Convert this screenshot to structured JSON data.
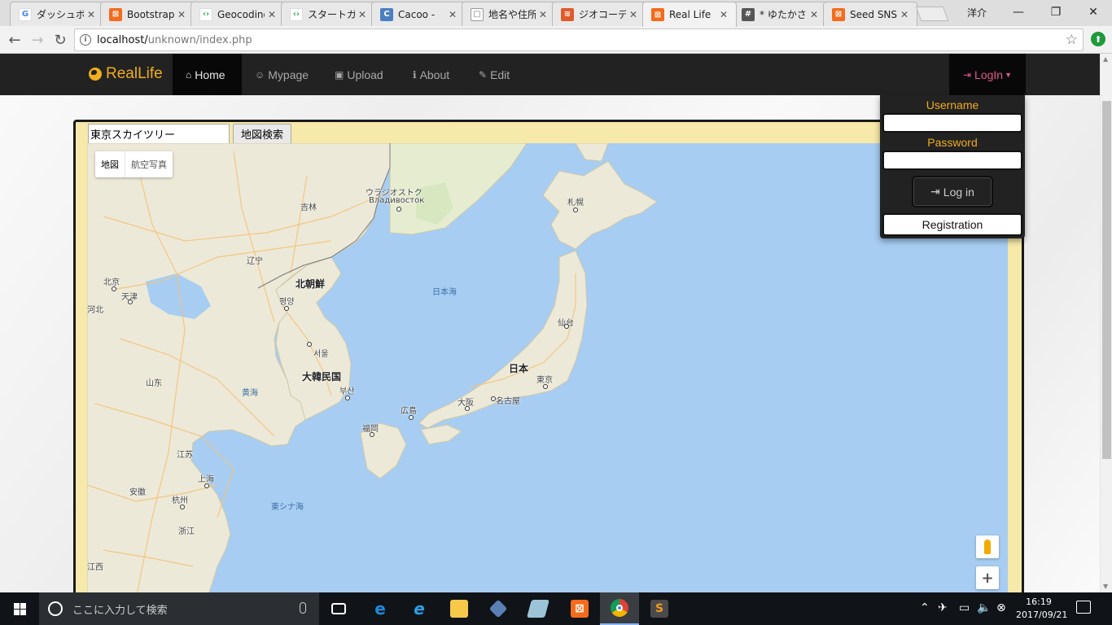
{
  "browser": {
    "tabs": [
      {
        "title": "ダッシュボード",
        "favicon": "google-icon",
        "color": "#4285f4",
        "glyph": "G"
      },
      {
        "title": "Bootstrap",
        "favicon": "xampp-icon",
        "color": "#f46b1c",
        "glyph": "⊠"
      },
      {
        "title": "Geocoding",
        "favicon": "google-developers-icon",
        "color": "#34a853",
        "glyph": "‹›"
      },
      {
        "title": "スタートガイド",
        "favicon": "google-developers-icon",
        "color": "#34a853",
        "glyph": "‹›"
      },
      {
        "title": "Cacoo - ",
        "favicon": "cacoo-icon",
        "color": "#4a7fc1",
        "glyph": "C"
      },
      {
        "title": "地名や住所",
        "favicon": "document-icon",
        "color": "#999999",
        "glyph": "▢"
      },
      {
        "title": "ジオコーディ",
        "favicon": "geo-icon",
        "color": "#e05a2a",
        "glyph": "≋"
      },
      {
        "title": "Real Life",
        "favicon": "xampp-icon",
        "color": "#f46b1c",
        "glyph": "⊠"
      },
      {
        "title": "* ゆたかさ",
        "favicon": "slack-icon",
        "color": "#555555",
        "glyph": "#"
      },
      {
        "title": "Seed SNS",
        "favicon": "xampp-icon",
        "color": "#f46b1c",
        "glyph": "⊠"
      }
    ],
    "active_tab_index": 7,
    "profile_name": "洋介",
    "url_host": "localhost/",
    "url_path": "unknown/index.php"
  },
  "navbar": {
    "brand": "RealLife",
    "items": [
      {
        "label": "Home",
        "icon": "home-icon",
        "glyph": "⌂"
      },
      {
        "label": "Mypage",
        "icon": "smile-icon",
        "glyph": "☺"
      },
      {
        "label": "Upload",
        "icon": "camera-icon",
        "glyph": "▣"
      },
      {
        "label": "About",
        "icon": "info-icon",
        "glyph": "ℹ"
      },
      {
        "label": "Edit",
        "icon": "edit-icon",
        "glyph": "✎"
      }
    ],
    "login_label": "LogIn"
  },
  "login_dropdown": {
    "username_label": "Username",
    "password_label": "Password",
    "login_button": "Log in",
    "register_button": "Registration"
  },
  "map": {
    "search_value": "東京スカイツリー",
    "search_button": "地図検索",
    "maptype_map": "地図",
    "maptype_satellite": "航空写真",
    "zoom_in": "+",
    "labels": {
      "vladivostok_ja": "ウラジオストク",
      "vladivostok_ru": "Владивосток",
      "jilin": "吉林",
      "sapporo": "札幌",
      "liaoning": "辽宁",
      "sea_of_japan": "日本海",
      "beijing": "北京",
      "tianjin": "天津",
      "hebei": "河北",
      "north_korea": "北朝鮮",
      "pyongyang": "평양",
      "sendai": "仙台",
      "seoul": "서울",
      "south_korea": "大韓民国",
      "japan": "日本",
      "tokyo": "東京",
      "shandong": "山东",
      "yellow_sea": "黄海",
      "busan": "부산",
      "nagoya": "名古屋",
      "osaka": "大阪",
      "hiroshima": "広島",
      "fukuoka": "福岡",
      "jiangsu": "江苏",
      "shanghai": "上海",
      "anhui": "安徽",
      "hangzhou": "杭州",
      "east_china_sea": "東シナ海",
      "zhejiang": "浙江",
      "jiangxi": "江西"
    }
  },
  "taskbar": {
    "search_placeholder": "ここに入力して検索",
    "time": "16:19",
    "date": "2017/09/21"
  }
}
